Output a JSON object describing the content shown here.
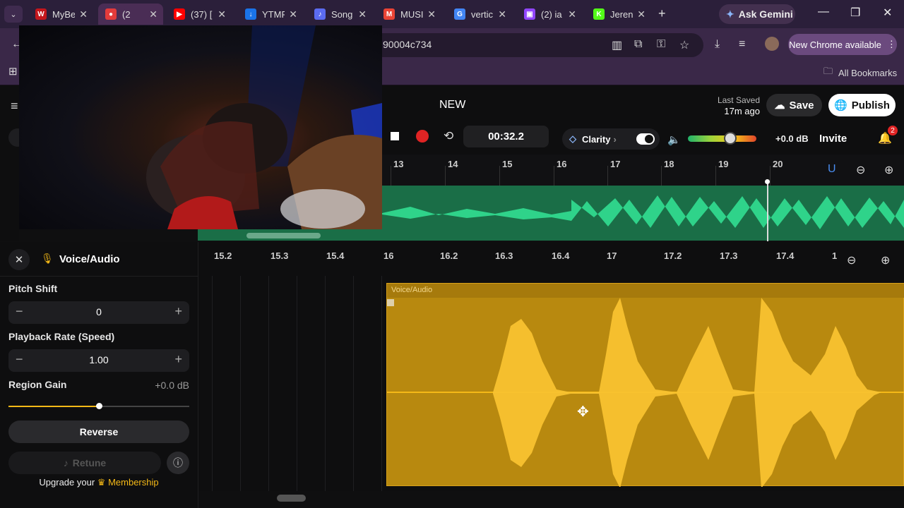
{
  "browser": {
    "tabs": [
      {
        "title": "MyBe",
        "icon": "W",
        "icon_color": "#c4161c"
      },
      {
        "title": "(2",
        "icon": "●",
        "icon_color": "#e33b3b"
      },
      {
        "title": "(37) [",
        "icon": "▶",
        "icon_color": "#ff0000"
      },
      {
        "title": "YTMP",
        "icon": "↓",
        "icon_color": "#1a73e8"
      },
      {
        "title": "Song",
        "icon": "♪",
        "icon_color": "#5b6bf0"
      },
      {
        "title": "MUSI",
        "icon": "M",
        "icon_color": "#ea4335"
      },
      {
        "title": "vertic",
        "icon": "G",
        "icon_color": "#4285f4"
      },
      {
        "title": "(2) ia",
        "icon": "▣",
        "icon_color": "#9146ff"
      },
      {
        "title": "Jeren",
        "icon": "K",
        "icon_color": "#53fc18"
      }
    ],
    "gemini_label": "Ask Gemini",
    "url_text": "90004c734",
    "new_chrome_label": "New Chrome available",
    "all_bookmarks_label": "All Bookmarks"
  },
  "header": {
    "project_name": "NEW",
    "last_saved_label": "Last Saved",
    "last_saved_time": "17m ago",
    "save_label": "Save",
    "publish_label": "Publish"
  },
  "transport": {
    "time": "00:32.2",
    "clarity_label": "Clarity",
    "volume_db": "+0.0 dB",
    "volume_level": 0.62,
    "invite_label": "Invite",
    "notification_count": "2"
  },
  "timeline_top": {
    "ticks": [
      "13",
      "14",
      "15",
      "16",
      "17",
      "18",
      "19",
      "20"
    ]
  },
  "timeline_bottom": {
    "ticks": [
      "15.2",
      "15.3",
      "15.4",
      "16",
      "16.2",
      "16.3",
      "16.4",
      "17",
      "17.2",
      "17.3",
      "17.4",
      "1"
    ],
    "region_label": "Voice/Audio"
  },
  "panel": {
    "title": "Voice/Audio",
    "pitch_label": "Pitch Shift",
    "pitch_value": "0",
    "rate_label": "Playback Rate (Speed)",
    "rate_value": "1.00",
    "gain_label": "Region Gain",
    "gain_value": "+0.0 dB",
    "gain_level": 0.5,
    "reverse_label": "Reverse",
    "retune_label": "Retune",
    "upgrade_text": "Upgrade your",
    "membership_label": "Membership"
  }
}
